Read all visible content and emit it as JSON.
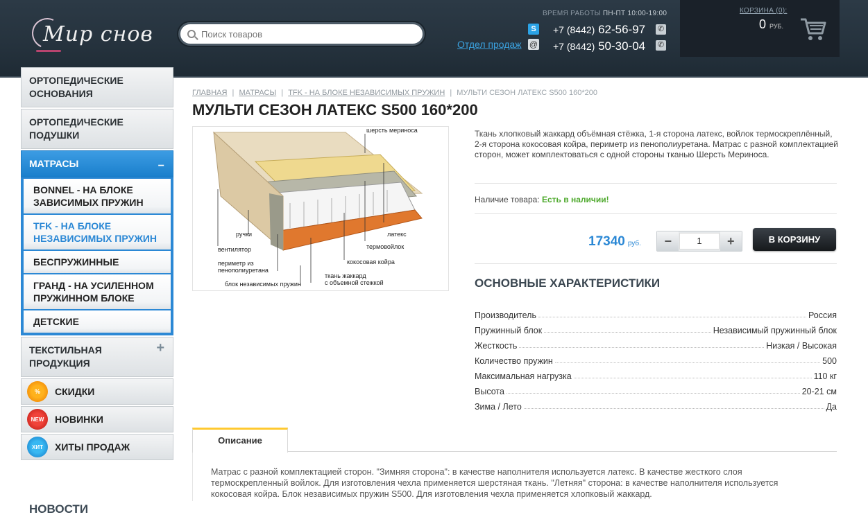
{
  "header": {
    "logo_text": "Мир снов",
    "search_placeholder": "Поиск товаров",
    "worktime_label": "ВРЕМЯ РАБОТЫ",
    "worktime_value": "ПН-ПТ 10:00-19:00",
    "sales_link": "Отдел продаж",
    "phone1_code": "+7 (8442)",
    "phone1_number": "62-56-97",
    "phone2_code": "+7 (8442)",
    "phone2_number": "50-30-04",
    "cart_title": "КОРЗИНА (0):",
    "cart_sum": "0",
    "cart_currency": "РУБ."
  },
  "sidebar": {
    "categories": [
      {
        "label": "ОРТОПЕДИЧЕСКИЕ ОСНОВАНИЯ"
      },
      {
        "label": "ОРТОПЕДИЧЕСКИЕ ПОДУШКИ"
      },
      {
        "label": "МАТРАСЫ",
        "sign": "−"
      }
    ],
    "subitems": [
      {
        "label": "BONNEL - НА БЛОКЕ ЗАВИСИМЫХ ПРУЖИН"
      },
      {
        "label": "TFK - НА БЛОКЕ НЕЗАВИСИМЫХ ПРУЖИН"
      },
      {
        "label": "БЕСПРУЖИННЫЕ"
      },
      {
        "label": "ГРАНД - НА УСИЛЕННОМ ПРУЖИННОМ БЛОКЕ"
      },
      {
        "label": "ДЕТСКИЕ"
      }
    ],
    "textile": {
      "label": "ТЕКСТИЛЬНАЯ ПРОДУКЦИЯ",
      "sign": "+"
    },
    "promos": [
      {
        "label": "СКИДКИ",
        "badge": "%"
      },
      {
        "label": "НОВИНКИ",
        "badge": "NEW"
      },
      {
        "label": "ХИТЫ ПРОДАЖ",
        "badge": "ХИТ"
      }
    ],
    "news_heading": "НОВОСТИ"
  },
  "breadcrumb": {
    "items": [
      "ГЛАВНАЯ",
      "МАТРАСЫ",
      "TFK - НА БЛОКЕ НЕЗАВИСИМЫХ ПРУЖИН"
    ],
    "current": "МУЛЬТИ СЕЗОН ЛАТЕКС S500 160*200",
    "separator": "|"
  },
  "product": {
    "title": "МУЛЬТИ СЕЗОН ЛАТЕКС S500 160*200",
    "description": "Ткань хлопковый жаккард объёмная стёжка, 1-я сторона латекс, войлок термоскреплённый, 2-я сторона кокосовая койра, периметр из пенополиуретана. Матрас с разной комплектацией сторон, может комплектоваться с одной стороны тканью Шерсть Мериноса.",
    "availability_label": "Наличие товара:",
    "availability_value": "Есть в наличии!",
    "price": "17340",
    "currency": "руб.",
    "quantity": "1",
    "minus": "−",
    "plus": "+",
    "add_to_cart": "В КОРЗИНУ",
    "image_labels": {
      "wool": "шерсть мериноса",
      "handles": "ручки",
      "vent": "вентилятор",
      "latex": "латекс",
      "felt": "термовойлок",
      "coir": "кокосовая койра",
      "perimeter1": "периметр из",
      "perimeter2": "пенополиуретана",
      "block": "блок независимых пружин",
      "fabric1": "ткань жаккард",
      "fabric2": "с объемной стежкой"
    }
  },
  "specs": {
    "heading": "ОСНОВНЫЕ ХАРАКТЕРИСТИКИ",
    "rows": [
      {
        "name": "Производитель",
        "value": "Россия"
      },
      {
        "name": "Пружинный блок",
        "value": "Независимый пружинный блок"
      },
      {
        "name": "Жесткость",
        "value": "Низкая / Высокая"
      },
      {
        "name": "Количество пружин",
        "value": "500"
      },
      {
        "name": "Максимальная нагрузка",
        "value": "110 кг"
      },
      {
        "name": "Высота",
        "value": "20-21 см"
      },
      {
        "name": "Зима / Лето",
        "value": "Да"
      }
    ]
  },
  "tabs": {
    "active": "Описание",
    "body": "Матрас с разной комплектацией сторон. \"Зимняя сторона\": в качестве наполнителя используется латекс. В качестве жесткого слоя термоскрепленный войлок. Для изготовления чехла применяется шерстяная ткань. \"Летняя\" сторона: в качестве наполнителя используется кокосовая койра. Блок независимых пружин S500. Для изготовления чехла применяется хлопковый жаккард."
  }
}
